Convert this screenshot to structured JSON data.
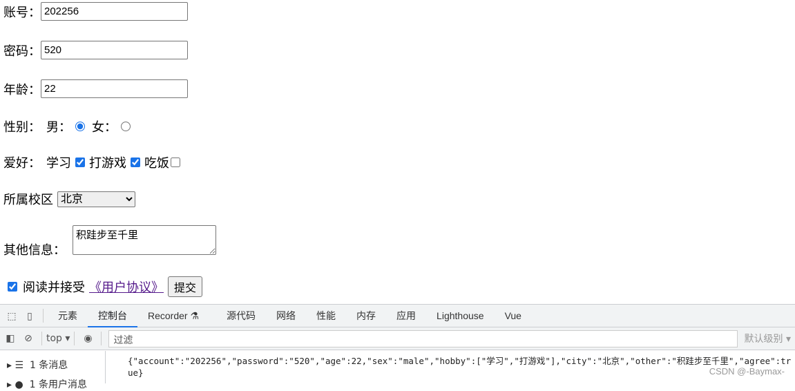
{
  "form": {
    "account_label": "账号：",
    "account_value": "202256",
    "password_label": "密码：",
    "password_value": "520",
    "age_label": "年龄：",
    "age_value": "22",
    "sex_label": "性别：",
    "male_label": "男：",
    "female_label": "女：",
    "hobby_label": "爱好：",
    "hobbies": [
      "学习",
      "打游戏",
      "吃饭"
    ],
    "city_label": "所属校区",
    "city_value": "北京",
    "other_label": "其他信息：",
    "other_value": "积跬步至千里",
    "agree_label": "阅读并接受",
    "agreement_link": "《用户协议》",
    "submit_label": "提交"
  },
  "devtools": {
    "tabs": [
      "元素",
      "控制台",
      "Recorder",
      "源代码",
      "网络",
      "性能",
      "内存",
      "应用",
      "Lighthouse",
      "Vue"
    ],
    "context": "top",
    "filter_placeholder": "过滤",
    "level": "默认级别",
    "sidebar": [
      "1 条消息",
      "1 条用户消息"
    ],
    "log": "{\"account\":\"202256\",\"password\":\"520\",\"age\":22,\"sex\":\"male\",\"hobby\":[\"学习\",\"打游戏\"],\"city\":\"北京\",\"other\":\"积跬步至千里\",\"agree\":true}",
    "watermark": "CSDN @-Baymax-"
  }
}
